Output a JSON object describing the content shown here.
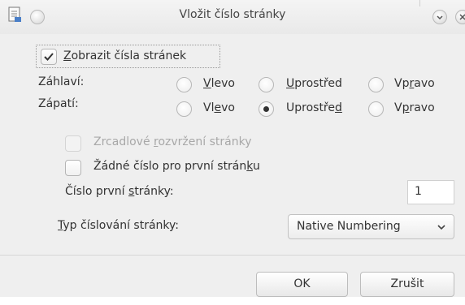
{
  "window": {
    "title": "Vložit číslo stránky"
  },
  "show_numbers": {
    "label_pre": "",
    "label_u": "Z",
    "label_post": "obrazit čísla stránek",
    "checked": true
  },
  "header": {
    "label": "Záhlaví:",
    "options": [
      {
        "pre": "",
        "u": "V",
        "post": "levo",
        "selected": false
      },
      {
        "pre": "",
        "u": "U",
        "post": "prostřed",
        "selected": false
      },
      {
        "pre": "Vp",
        "u": "r",
        "post": "avo",
        "selected": false
      }
    ]
  },
  "footer": {
    "label": "Zápatí:",
    "options": [
      {
        "pre": "Vl",
        "u": "e",
        "post": "vo",
        "selected": false
      },
      {
        "pre": "Uprostře",
        "u": "d",
        "post": "",
        "selected": true
      },
      {
        "pre": "V",
        "u": "p",
        "post": "ravo",
        "selected": false
      }
    ]
  },
  "mirror": {
    "pre": "Zrcadlové ",
    "u": "r",
    "post": "ozvržení stránky",
    "enabled": false
  },
  "no_first": {
    "pre": "Žádné číslo pro první strán",
    "u": "k",
    "post": "u",
    "checked": false
  },
  "first_page": {
    "pre": "Číslo první ",
    "u": "s",
    "post": "tránky:",
    "value": "1"
  },
  "numbering": {
    "pre": "",
    "u": "T",
    "post": "yp číslování stránky:",
    "selected": "Native Numbering"
  },
  "buttons": {
    "ok": "OK",
    "cancel": "Zrušit"
  }
}
